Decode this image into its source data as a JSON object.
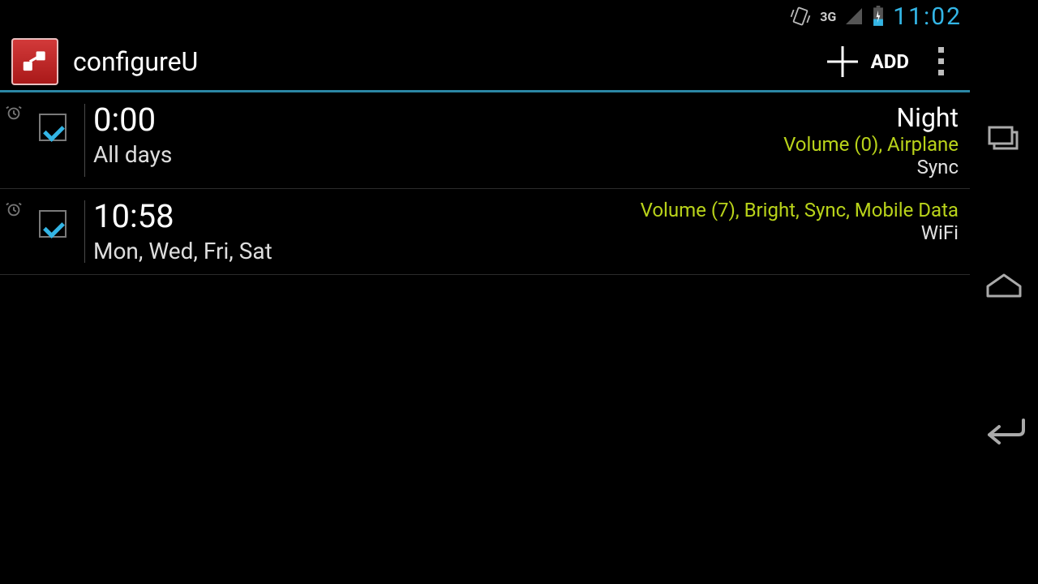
{
  "status": {
    "network_label": "3G",
    "clock": "11:02"
  },
  "actionbar": {
    "title": "configureU",
    "add_label": "ADD"
  },
  "rows": [
    {
      "checked": true,
      "time": "0:00",
      "days": "All days",
      "name": "Night",
      "actions_on": "Volume (0), Airplane",
      "actions_off": "Sync"
    },
    {
      "checked": true,
      "time": "10:58",
      "days": "Mon, Wed, Fri, Sat",
      "name": "",
      "actions_on": "Volume (7), Bright, Sync, Mobile Data",
      "actions_off": "WiFi"
    }
  ]
}
